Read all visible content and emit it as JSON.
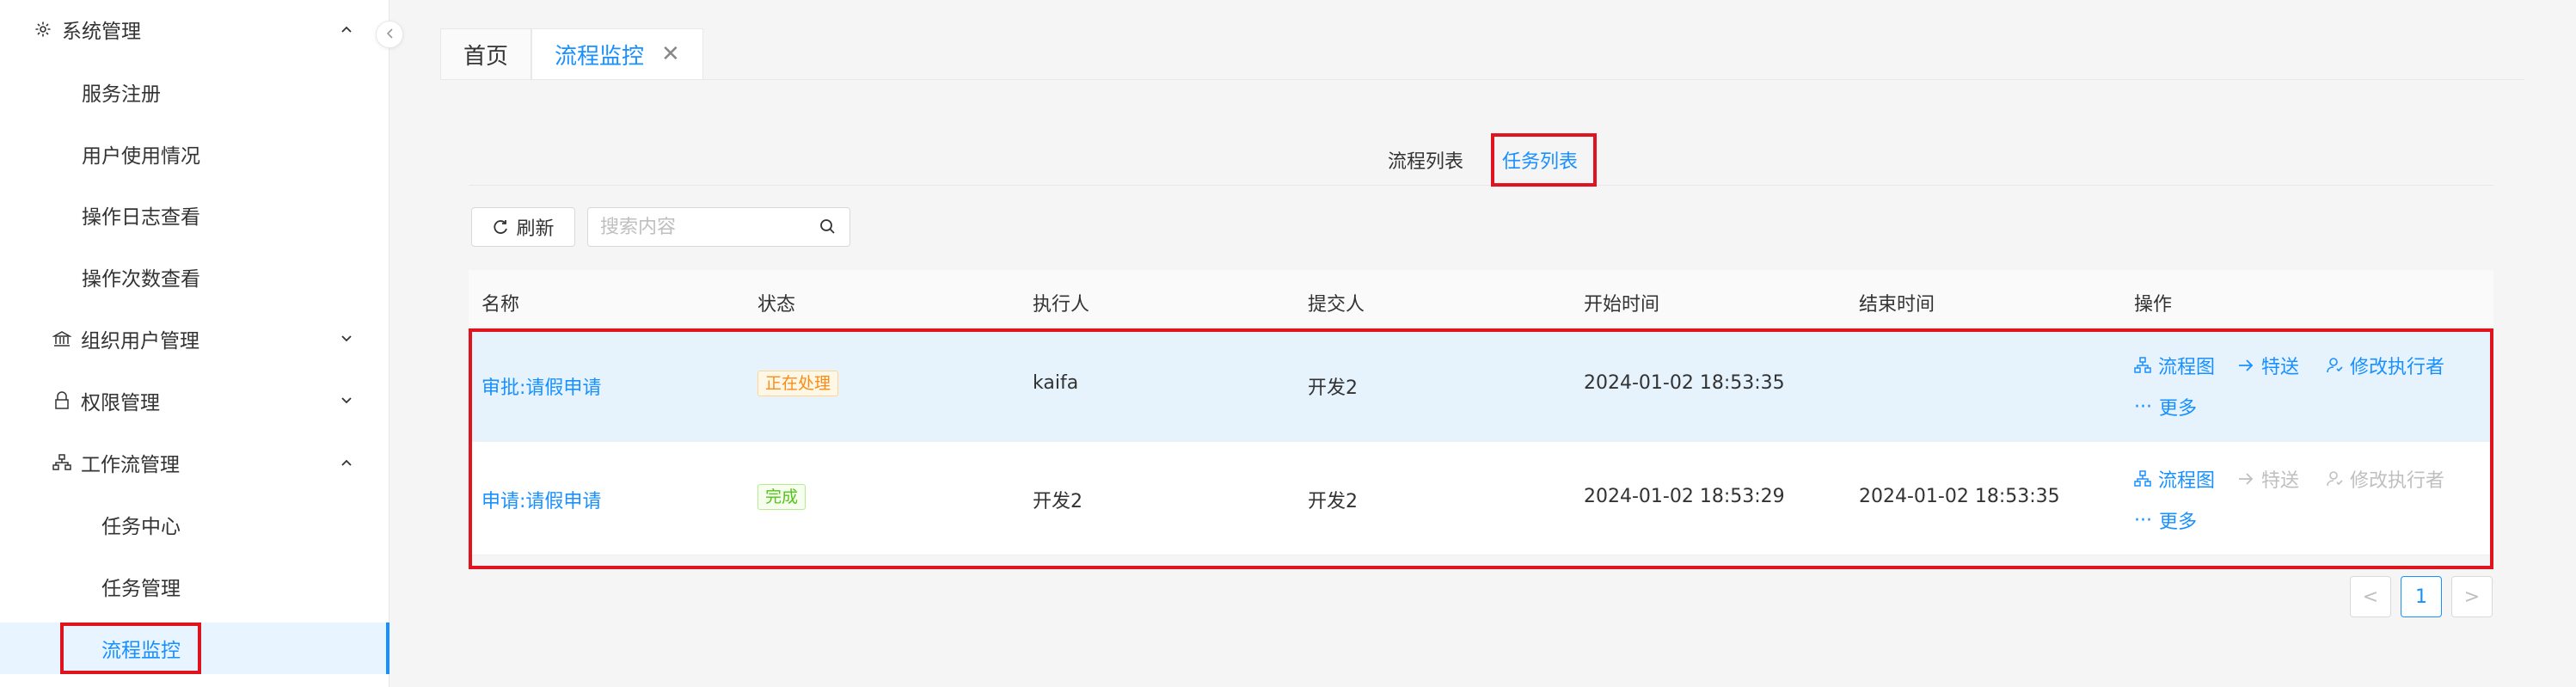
{
  "sidebar": {
    "groups": [
      {
        "label": "系统管理",
        "icon": "gear-icon",
        "expanded": true
      },
      {
        "label": "组织用户管理",
        "icon": "bank-icon",
        "expanded": false
      },
      {
        "label": "权限管理",
        "icon": "lock-icon",
        "expanded": false
      },
      {
        "label": "工作流管理",
        "icon": "flow-icon",
        "expanded": true
      }
    ],
    "system_items": [
      "服务注册",
      "用户使用情况",
      "操作日志查看",
      "操作次数查看"
    ],
    "workflow_items": [
      "任务中心",
      "任务管理",
      "流程监控"
    ],
    "active_item": "流程监控"
  },
  "page_tabs": [
    {
      "label": "首页",
      "active": false
    },
    {
      "label": "流程监控",
      "active": true,
      "closable": true
    }
  ],
  "sub_tabs": [
    {
      "label": "流程列表",
      "active": false
    },
    {
      "label": "任务列表",
      "active": true
    }
  ],
  "toolbar": {
    "refresh_label": "刷新",
    "search_placeholder": "搜索内容"
  },
  "table": {
    "headers": [
      "名称",
      "状态",
      "执行人",
      "提交人",
      "开始时间",
      "结束时间",
      "操作"
    ],
    "rows": [
      {
        "name": "审批:请假申请",
        "status": "正在处理",
        "status_type": "processing",
        "executor": "kaifa",
        "submitter": "开发2",
        "start_time": "2024-01-02 18:53:35",
        "end_time": "",
        "actions": {
          "diagram": "流程图",
          "forward": "特送",
          "change_executor": "修改执行者",
          "more": "更多"
        },
        "actions_enabled": true
      },
      {
        "name": "申请:请假申请",
        "status": "完成",
        "status_type": "done",
        "executor": "开发2",
        "submitter": "开发2",
        "start_time": "2024-01-02 18:53:29",
        "end_time": "2024-01-02 18:53:35",
        "actions": {
          "diagram": "流程图",
          "forward": "特送",
          "change_executor": "修改执行者",
          "more": "更多"
        },
        "actions_enabled": false
      }
    ]
  },
  "pagination": {
    "prev": "<",
    "current": "1",
    "next": ">"
  },
  "colors": {
    "accent": "#1890ff",
    "highlight": "#e0141e",
    "row_highlight": "#e6f3fd"
  }
}
